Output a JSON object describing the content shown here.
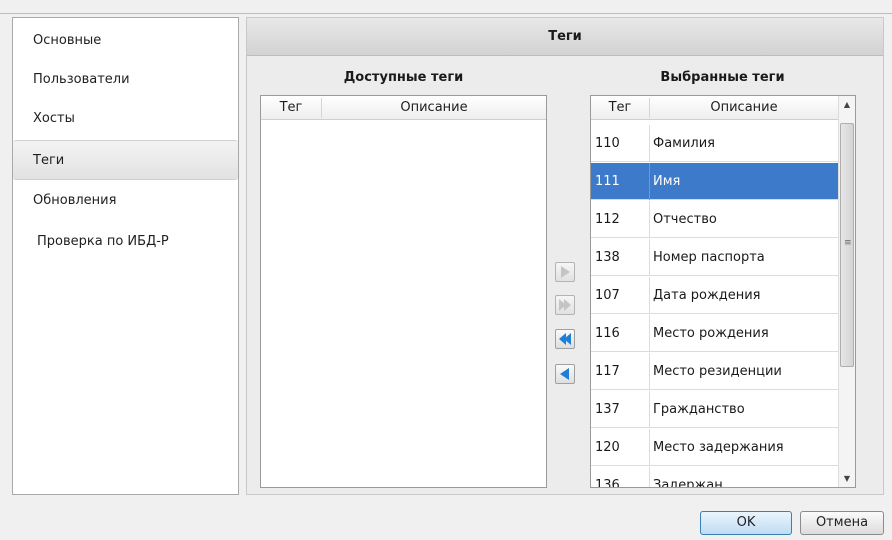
{
  "sidebar": {
    "items": [
      {
        "label": "Основные",
        "selected": false
      },
      {
        "label": "Пользователи",
        "selected": false
      },
      {
        "label": "Хосты",
        "selected": false
      },
      {
        "label": "Теги",
        "selected": true
      },
      {
        "label": "Обновления",
        "selected": false
      },
      {
        "label": "Проверка по ИБД-Р",
        "selected": false
      }
    ]
  },
  "panel": {
    "title": "Теги",
    "available": {
      "label": "Доступные теги",
      "col_tag": "Тег",
      "col_desc": "Описание",
      "rows": []
    },
    "selected": {
      "label": "Выбранные теги",
      "col_tag": "Тег",
      "col_desc": "Описание",
      "rows": [
        {
          "tag": "110",
          "desc": "Фамилия",
          "selected": false
        },
        {
          "tag": "111",
          "desc": "Имя",
          "selected": true
        },
        {
          "tag": "112",
          "desc": "Отчество",
          "selected": false
        },
        {
          "tag": "138",
          "desc": "Номер паспорта",
          "selected": false
        },
        {
          "tag": "107",
          "desc": "Дата рождения",
          "selected": false
        },
        {
          "tag": "116",
          "desc": "Место рождения",
          "selected": false
        },
        {
          "tag": "117",
          "desc": "Место резиденции",
          "selected": false
        },
        {
          "tag": "137",
          "desc": "Гражданство",
          "selected": false
        },
        {
          "tag": "120",
          "desc": "Место задержания",
          "selected": false
        },
        {
          "tag": "136",
          "desc": "Задержан",
          "selected": false
        }
      ]
    },
    "move_buttons": [
      {
        "icon": "arrow-right-icon",
        "enabled": false
      },
      {
        "icon": "double-arrow-right-icon",
        "enabled": false
      },
      {
        "icon": "double-arrow-left-icon",
        "enabled": true
      },
      {
        "icon": "arrow-left-icon",
        "enabled": true
      }
    ]
  },
  "buttons": {
    "ok_label": "OK",
    "cancel_label": "Отмена"
  },
  "colors": {
    "selection": "#3d7ac9",
    "arrow_enabled": "#1e7fd6",
    "arrow_disabled": "#b9b9b9"
  }
}
